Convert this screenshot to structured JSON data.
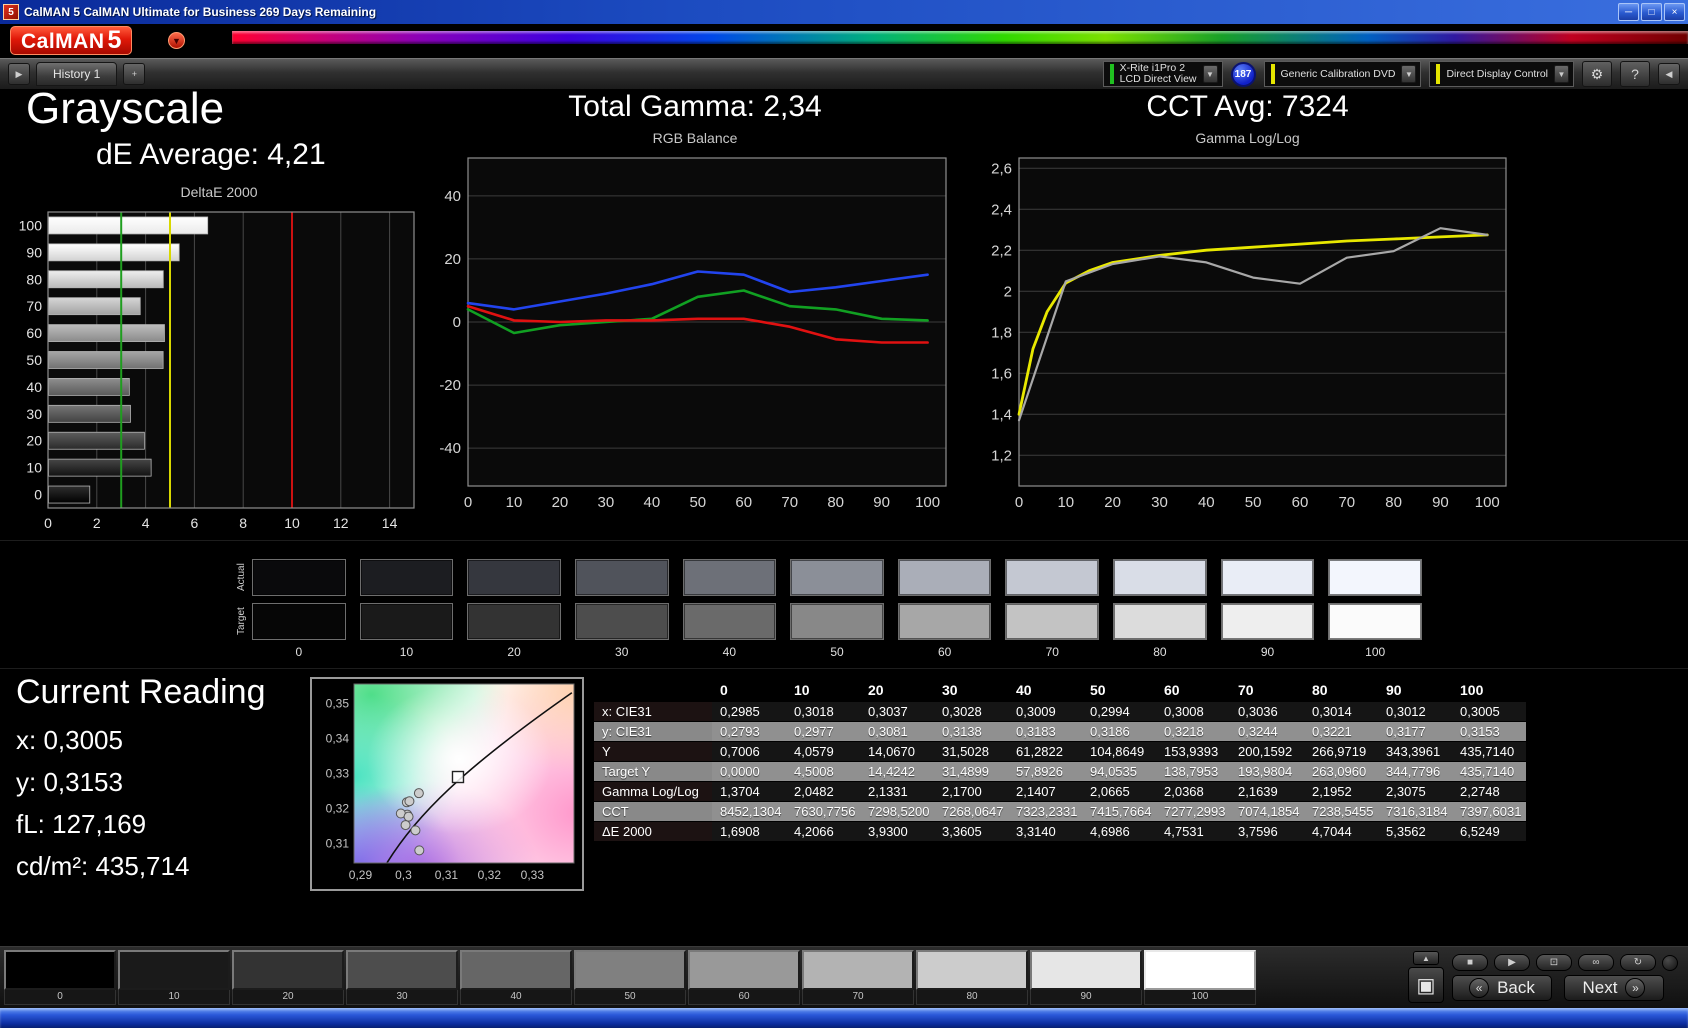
{
  "window": {
    "title": "CalMAN 5 CalMAN Ultimate for Business 269 Days Remaining"
  },
  "logo": {
    "brand": "CalMAN",
    "five": "5"
  },
  "icons": {
    "minimize": "─",
    "restore": "□",
    "close": "×",
    "dropdown": "▼",
    "gear": "⚙",
    "help": "?",
    "panel_right": "▶",
    "panel_left": "◀",
    "stop": "■",
    "play": "▶",
    "pattern": "⊡",
    "infinity": "∞",
    "loop": "↻",
    "tray_up": "▲",
    "window_pattern": "▣",
    "back_chev": "«",
    "next_chev": "»"
  },
  "toolbar": {
    "tab_label": "History 1",
    "add_tab": "+",
    "meter_line1": "X-Rite i1Pro 2",
    "meter_line2": "LCD Direct View",
    "badge": "187",
    "workflow": "Generic Calibration DVD",
    "display_ctrl": "Direct Display Control"
  },
  "headings": {
    "grayscale": "Grayscale",
    "de_avg": "dE Average: 4,21",
    "total_gamma": "Total Gamma: 2,34",
    "cct_avg": "CCT Avg: 7324"
  },
  "chart_data": [
    {
      "type": "bar",
      "title": "DeltaE 2000",
      "orientation": "horizontal",
      "categories": [
        100,
        90,
        80,
        70,
        60,
        50,
        40,
        30,
        20,
        10,
        0
      ],
      "values": [
        6.5249,
        5.3562,
        4.7044,
        3.7596,
        4.7531,
        4.6986,
        3.314,
        3.3605,
        3.93,
        4.2066,
        1.6908
      ],
      "xlim": [
        0,
        15
      ],
      "xticks": [
        0,
        2,
        4,
        6,
        8,
        10,
        12,
        14
      ],
      "ref_lines": [
        {
          "v": 3,
          "color": "#1f9e1f"
        },
        {
          "v": 5,
          "color": "#d8d800"
        },
        {
          "v": 10,
          "color": "#cc1111"
        }
      ]
    },
    {
      "type": "line",
      "title": "RGB Balance",
      "xlim": [
        0,
        104
      ],
      "ylim": [
        -52,
        52
      ],
      "xticks": [
        0,
        10,
        20,
        30,
        40,
        50,
        60,
        70,
        80,
        90,
        100
      ],
      "yticks": [
        {
          "v": 40,
          "label": "40"
        },
        {
          "v": 20,
          "label": "20"
        },
        {
          "v": 0,
          "label": "0"
        },
        {
          "v": -20,
          "label": "-20"
        },
        {
          "v": -40,
          "label": "-40"
        }
      ],
      "series": [
        {
          "name": "Blue",
          "color": "#2244ee",
          "x": [
            0,
            10,
            20,
            30,
            40,
            50,
            60,
            70,
            80,
            90,
            100
          ],
          "values": [
            6,
            4,
            6.5,
            9,
            12,
            16,
            15,
            9.5,
            11,
            13,
            15
          ]
        },
        {
          "name": "Green",
          "color": "#11a022",
          "x": [
            0,
            10,
            20,
            30,
            40,
            50,
            60,
            70,
            80,
            90,
            100
          ],
          "values": [
            4,
            -3.5,
            -1,
            0,
            1,
            8,
            10,
            5,
            4,
            1,
            0.5
          ]
        },
        {
          "name": "Red",
          "color": "#e01111",
          "x": [
            0,
            10,
            20,
            30,
            40,
            50,
            60,
            70,
            80,
            90,
            100
          ],
          "values": [
            5,
            0.5,
            0,
            0.5,
            0.5,
            1,
            1,
            -1.5,
            -5.5,
            -6.5,
            -6.5
          ]
        }
      ]
    },
    {
      "type": "line",
      "title": "Gamma Log/Log",
      "xlim": [
        0,
        104
      ],
      "ylim": [
        1.05,
        2.65
      ],
      "xticks": [
        0,
        10,
        20,
        30,
        40,
        50,
        60,
        70,
        80,
        90,
        100
      ],
      "yticks": [
        {
          "v": 2.6,
          "label": "2,6"
        },
        {
          "v": 2.4,
          "label": "2,4"
        },
        {
          "v": 2.2,
          "label": "2,2"
        },
        {
          "v": 2.0,
          "label": "2"
        },
        {
          "v": 1.8,
          "label": "1,8"
        },
        {
          "v": 1.6,
          "label": "1,6"
        },
        {
          "v": 1.4,
          "label": "1,4"
        },
        {
          "v": 1.2,
          "label": "1,2"
        }
      ],
      "series": [
        {
          "name": "Target",
          "color": "#e8e800",
          "width": 2.8,
          "x": [
            0,
            3,
            6,
            10,
            15,
            20,
            30,
            40,
            50,
            60,
            70,
            80,
            90,
            100
          ],
          "values": [
            1.4,
            1.72,
            1.9,
            2.04,
            2.1,
            2.14,
            2.175,
            2.2,
            2.215,
            2.23,
            2.245,
            2.255,
            2.265,
            2.275
          ]
        },
        {
          "name": "Measured",
          "color": "#a8a8a8",
          "width": 2.2,
          "x": [
            0,
            10,
            20,
            30,
            40,
            50,
            60,
            70,
            80,
            90,
            100
          ],
          "values": [
            1.3704,
            2.0482,
            2.1331,
            2.17,
            2.1407,
            2.0665,
            2.0368,
            2.1639,
            2.1952,
            2.3075,
            2.2748
          ]
        }
      ]
    },
    {
      "type": "scatter",
      "xlim": [
        0.2885,
        0.3397
      ],
      "ylim": [
        0.3045,
        0.3555
      ],
      "xticks": [
        {
          "v": 0.29,
          "label": "0,29"
        },
        {
          "v": 0.3,
          "label": "0,3"
        },
        {
          "v": 0.31,
          "label": "0,31"
        },
        {
          "v": 0.32,
          "label": "0,32"
        },
        {
          "v": 0.33,
          "label": "0,33"
        }
      ],
      "yticks": [
        {
          "v": 0.35,
          "label": "0,35"
        },
        {
          "v": 0.34,
          "label": "0,34"
        },
        {
          "v": 0.33,
          "label": "0,33"
        },
        {
          "v": 0.32,
          "label": "0,32"
        },
        {
          "v": 0.31,
          "label": "0,31"
        }
      ],
      "target": {
        "x": 0.3127,
        "y": 0.329
      },
      "points": [
        [
          0.2985,
          0.2793
        ],
        [
          0.3018,
          0.2977
        ],
        [
          0.3037,
          0.3081
        ],
        [
          0.3028,
          0.3138
        ],
        [
          0.3009,
          0.3183
        ],
        [
          0.2994,
          0.3186
        ],
        [
          0.3008,
          0.3218
        ],
        [
          0.3036,
          0.3244
        ],
        [
          0.3014,
          0.3221
        ],
        [
          0.3012,
          0.3177
        ],
        [
          0.3005,
          0.3153
        ]
      ]
    }
  ],
  "swatches": {
    "row1_label": "Actual",
    "row2_label": "Target",
    "columns": [
      "0",
      "10",
      "20",
      "30",
      "40",
      "50",
      "60",
      "70",
      "80",
      "90",
      "100"
    ],
    "actual": [
      "#0a0a0c",
      "#1c1d21",
      "#35373e",
      "#50535b",
      "#6d7078",
      "#8b8f98",
      "#aaaeb8",
      "#c4c8d2",
      "#d9dde7",
      "#e9edf6",
      "#f3f6fd"
    ],
    "target": [
      "#060606",
      "#1a1a1a",
      "#333333",
      "#4d4d4d",
      "#6a6a6a",
      "#888888",
      "#a7a7a7",
      "#c3c3c3",
      "#dcdcdc",
      "#eeeeee",
      "#fbfbfb"
    ]
  },
  "reading": {
    "title": "Current Reading",
    "lines": [
      "x: 0,3005",
      "y: 0,3153",
      "fL: 127,169",
      "cd/m²: 435,714"
    ]
  },
  "table": {
    "header": [
      "",
      "0",
      "10",
      "20",
      "30",
      "40",
      "50",
      "60",
      "70",
      "80",
      "90",
      "100"
    ],
    "rows": [
      {
        "label": "x: CIE31",
        "values": [
          "0,2985",
          "0,3018",
          "0,3037",
          "0,3028",
          "0,3009",
          "0,2994",
          "0,3008",
          "0,3036",
          "0,3014",
          "0,3012",
          "0,3005"
        ]
      },
      {
        "label": "y: CIE31",
        "values": [
          "0,2793",
          "0,2977",
          "0,3081",
          "0,3138",
          "0,3183",
          "0,3186",
          "0,3218",
          "0,3244",
          "0,3221",
          "0,3177",
          "0,3153"
        ]
      },
      {
        "label": "Y",
        "values": [
          "0,7006",
          "4,0579",
          "14,0670",
          "31,5028",
          "61,2822",
          "104,8649",
          "153,9393",
          "200,1592",
          "266,9719",
          "343,3961",
          "435,7140"
        ]
      },
      {
        "label": "Target Y",
        "values": [
          "0,0000",
          "4,5008",
          "14,4242",
          "31,4899",
          "57,8926",
          "94,0535",
          "138,7953",
          "193,9804",
          "263,0960",
          "344,7796",
          "435,7140"
        ]
      },
      {
        "label": "Gamma Log/Log",
        "values": [
          "1,3704",
          "2,0482",
          "2,1331",
          "2,1700",
          "2,1407",
          "2,0665",
          "2,0368",
          "2,1639",
          "2,1952",
          "2,3075",
          "2,2748"
        ]
      },
      {
        "label": "CCT",
        "values": [
          "8452,1304",
          "7630,7756",
          "7298,5200",
          "7268,0647",
          "7323,2331",
          "7415,7664",
          "7277,2993",
          "7074,1854",
          "7238,5455",
          "7316,3184",
          "7397,6031"
        ]
      },
      {
        "label": "ΔE 2000",
        "values": [
          "1,6908",
          "4,2066",
          "3,9300",
          "3,3605",
          "3,3140",
          "4,6986",
          "4,7531",
          "3,7596",
          "4,7044",
          "5,3562",
          "6,5249"
        ]
      }
    ]
  },
  "bottom": {
    "levels": [
      "0",
      "10",
      "20",
      "30",
      "40",
      "50",
      "60",
      "70",
      "80",
      "90",
      "100"
    ],
    "colors": [
      "#000000",
      "#1a1a1a",
      "#333333",
      "#4d4d4d",
      "#666666",
      "#808080",
      "#999999",
      "#b3b3b3",
      "#cccccc",
      "#e6e6e6",
      "#ffffff"
    ],
    "selected_index": 10,
    "back": "Back",
    "next": "Next"
  }
}
